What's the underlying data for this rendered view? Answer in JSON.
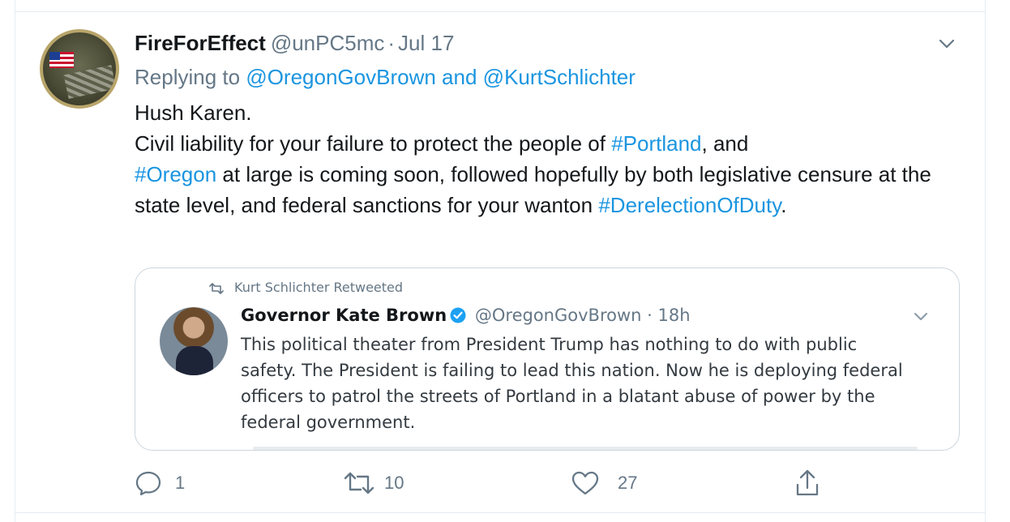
{
  "tweet": {
    "display_name": "FireForEffect",
    "handle": "@unPC5mc",
    "separator": "·",
    "date": "Jul 17",
    "replying_prefix": "Replying to",
    "replying_to_1": "@OregonGovBrown",
    "replying_and": "and",
    "replying_to_2": "@KurtSchlichter",
    "text": {
      "line1": "Hush Karen.",
      "part_a": "Civil liability for your failure to protect the people of ",
      "hashtag_portland": "#Portland",
      "part_b": ", and",
      "hashtag_oregon": "#Oregon",
      "part_c": " at large is coming soon, followed hopefully by both legislative censure at the state level, and federal sanctions for your wanton ",
      "hashtag_dereliction": "#DerelectionOfDuty",
      "part_d": "."
    },
    "quoted": {
      "retweeted_by": "Kurt Schlichter Retweeted",
      "name": "Governor Kate Brown",
      "handle": "@OregonGovBrown",
      "separator": "·",
      "time": "18h",
      "text": "This political theater from President Trump has nothing to do with public safety. The President is failing to lead this nation. Now he is deploying federal officers to patrol the streets of Portland in a blatant abuse of power by the federal government."
    },
    "actions": {
      "replies": "1",
      "retweets": "10",
      "likes": "27"
    }
  },
  "colors": {
    "link": "#1b95e0",
    "muted": "#657786",
    "border": "#ccd6dd",
    "verified": "#1da1f2"
  },
  "icons": [
    "chevron-down-icon",
    "retweet-icon",
    "verified-icon",
    "reply-icon",
    "like-icon",
    "share-icon"
  ]
}
